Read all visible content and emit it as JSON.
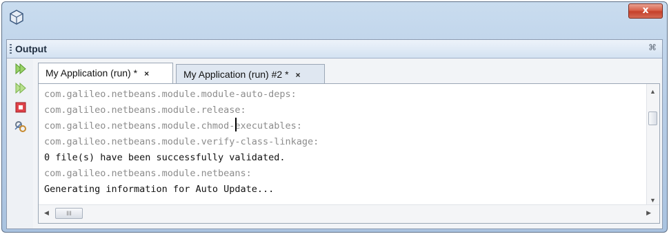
{
  "window": {
    "close_label": "x"
  },
  "panel": {
    "title": "Output",
    "close_glyph": "⌘"
  },
  "toolbar": {
    "icons": [
      "rerun-icon",
      "rerun-with-args-icon",
      "stop-icon",
      "settings-icon"
    ]
  },
  "tabs": [
    {
      "label": "My Application (run) *",
      "close": "×",
      "active": true
    },
    {
      "label": "My Application (run) #2 *",
      "close": "×",
      "active": false
    }
  ],
  "output_lines": [
    {
      "text": "com.galileo.netbeans.module.module-auto-deps:",
      "style": "gray"
    },
    {
      "text": "com.galileo.netbeans.module.release:",
      "style": "gray"
    },
    {
      "text": "com.galileo.netbeans.module.chmod-executables:",
      "style": "gray"
    },
    {
      "text": "com.galileo.netbeans.module.verify-class-linkage:",
      "style": "gray"
    },
    {
      "text": "0 file(s) have been successfully validated.",
      "style": "black"
    },
    {
      "text": "com.galileo.netbeans.module.netbeans:",
      "style": "gray"
    },
    {
      "text": "Generating information for Auto Update...",
      "style": "black"
    }
  ],
  "scrollbar": {
    "hthumb_glyph": "III"
  }
}
